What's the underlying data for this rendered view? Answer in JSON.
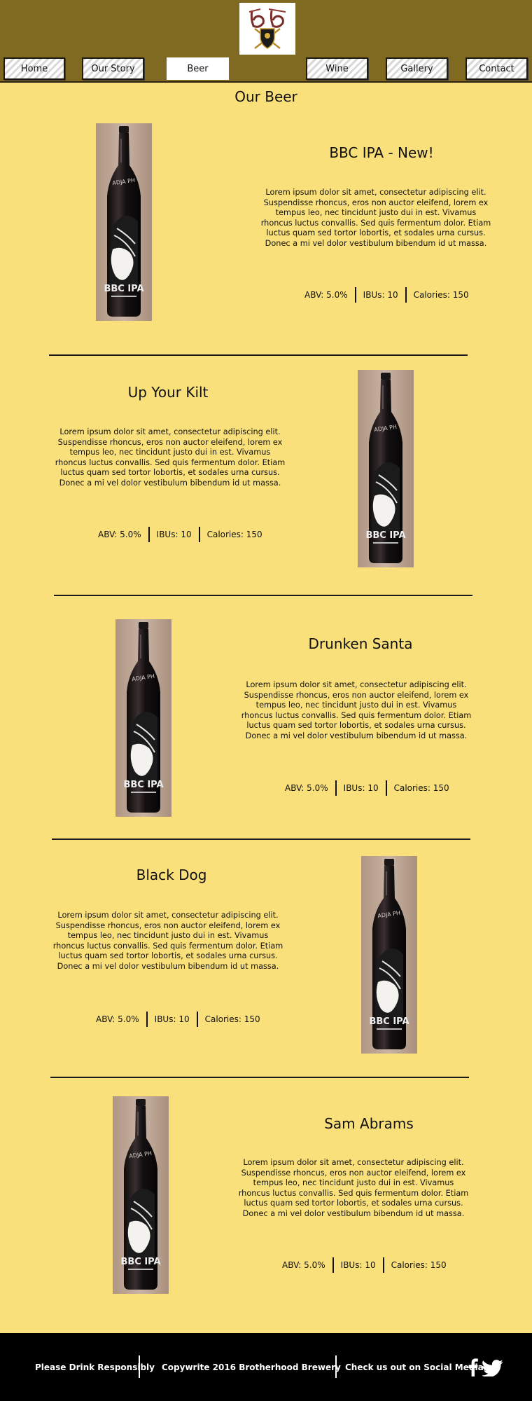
{
  "nav": {
    "items": [
      {
        "label": "Home"
      },
      {
        "label": "Our Story"
      },
      {
        "label": "Beer"
      },
      {
        "label": "Wine"
      },
      {
        "label": "Gallery"
      },
      {
        "label": "Contact"
      }
    ],
    "active": "Beer"
  },
  "main": {
    "title": "Our Beer",
    "beers": [
      {
        "name": "BBC IPA - New!",
        "description": "Lorem ipsum dolor sit amet, consectetur adipiscing elit. Suspendisse rhoncus, eros non auctor eleifend, lorem ex tempus leo, nec tincidunt justo dui in est. Vivamus rhoncus luctus convallis. Sed quis fermentum dolor. Etiam luctus quam sed tortor lobortis, et sodales urna cursus. Donec a mi vel dolor vestibulum bibendum id ut massa.",
        "abv": "ABV: 5.0%",
        "ibus": "IBUs: 10",
        "calories": "Calories: 150",
        "bottle_label": "BBC IPA"
      },
      {
        "name": "Up Your Kilt",
        "description": "Lorem ipsum dolor sit amet, consectetur adipiscing elit. Suspendisse rhoncus, eros non auctor eleifend, lorem ex tempus leo, nec tincidunt justo dui in est. Vivamus rhoncus luctus convallis. Sed quis fermentum dolor. Etiam luctus quam sed tortor lobortis, et sodales urna cursus. Donec a mi vel dolor vestibulum bibendum id ut massa.",
        "abv": "ABV: 5.0%",
        "ibus": "IBUs: 10",
        "calories": "Calories: 150",
        "bottle_label": "BBC IPA"
      },
      {
        "name": "Drunken Santa",
        "description": "Lorem ipsum dolor sit amet, consectetur adipiscing elit. Suspendisse rhoncus, eros non auctor eleifend, lorem ex tempus leo, nec tincidunt justo dui in est. Vivamus rhoncus luctus convallis. Sed quis fermentum dolor. Etiam luctus quam sed tortor lobortis, et sodales urna cursus. Donec a mi vel dolor vestibulum bibendum id ut massa.",
        "abv": "ABV: 5.0%",
        "ibus": "IBUs: 10",
        "calories": "Calories: 150",
        "bottle_label": "BBC IPA"
      },
      {
        "name": "Black Dog",
        "description": "Lorem ipsum dolor sit amet, consectetur adipiscing elit. Suspendisse rhoncus, eros non auctor eleifend, lorem ex tempus leo, nec tincidunt justo dui in est. Vivamus rhoncus luctus convallis. Sed quis fermentum dolor. Etiam luctus quam sed tortor lobortis, et sodales urna cursus. Donec a mi vel dolor vestibulum bibendum id ut massa.",
        "abv": "ABV: 5.0%",
        "ibus": "IBUs: 10",
        "calories": "Calories: 150",
        "bottle_label": "BBC IPA"
      },
      {
        "name": "Sam Abrams",
        "description": "Lorem ipsum dolor sit amet, consectetur adipiscing elit. Suspendisse rhoncus, eros non auctor eleifend, lorem ex tempus leo, nec tincidunt justo dui in est. Vivamus rhoncus luctus convallis. Sed quis fermentum dolor. Etiam luctus quam sed tortor lobortis, et sodales urna cursus. Donec a mi vel dolor vestibulum bibendum id ut massa.",
        "abv": "ABV: 5.0%",
        "ibus": "IBUs: 10",
        "calories": "Calories: 150",
        "bottle_label": "BBC IPA"
      }
    ]
  },
  "footer": {
    "responsibly": "Please Drink Responsibly",
    "copyright": "Copywrite 2016 Brotherhood Brewery",
    "social": "Check us out on Social Media:",
    "icons": [
      "facebook-icon",
      "twitter-icon"
    ]
  },
  "colors": {
    "page_background": "#fae07b",
    "header_background": "#806a22",
    "footer_background": "#000000"
  }
}
